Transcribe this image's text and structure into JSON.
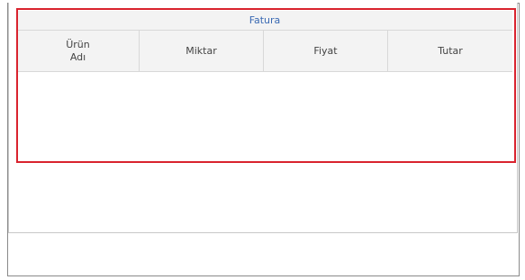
{
  "panel": {
    "title": "Fatura",
    "columns": [
      "Ürün\nAdı",
      "Miktar",
      "Fiyat",
      "Tutar"
    ],
    "rows": []
  },
  "colors": {
    "highlight": "#d9232e",
    "title_text": "#3a6ab3",
    "header_bg": "#f3f3f3"
  }
}
